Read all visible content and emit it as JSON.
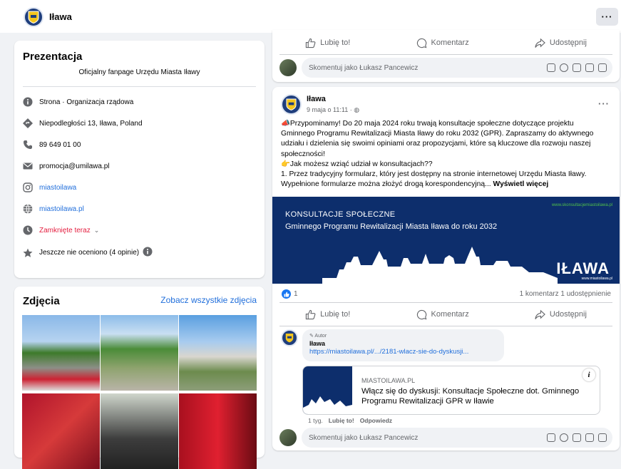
{
  "page": {
    "name": "Iława",
    "more": "···"
  },
  "about": {
    "title": "Prezentacja",
    "description": "Oficjalny fanpage Urzędu Miasta Iławy",
    "items": [
      {
        "icon": "info-icon",
        "text": "Strona · Organizacja rządowa"
      },
      {
        "icon": "location-icon",
        "text": "Niepodległości 13, Iława, Poland"
      },
      {
        "icon": "phone-icon",
        "text": "89 649 01 00"
      },
      {
        "icon": "email-icon",
        "text": "promocja@umilawa.pl"
      },
      {
        "icon": "instagram-icon",
        "text": "miastoilawa"
      },
      {
        "icon": "globe-icon",
        "text": "miastoilawa.pl"
      },
      {
        "icon": "clock-icon",
        "text": "Zamknięte teraz"
      },
      {
        "icon": "star-icon",
        "text": "Jeszcze nie oceniono (4 opinie)"
      }
    ]
  },
  "photos": {
    "title": "Zdjęcia",
    "see_all": "Zobacz wszystkie zdjęcia"
  },
  "actions": {
    "like": "Lubię to!",
    "comment": "Komentarz",
    "share": "Udostępnij"
  },
  "comment_box": {
    "placeholder": "Skomentuj jako Łukasz Pancewicz"
  },
  "post": {
    "author": "Iława",
    "date": "9 maja o 11:11 · ",
    "text_lines": [
      "📣Przypominamy! Do 20 maja 2024 roku trwają konsultacje społeczne dotyczące projektu",
      "Gminnego Programu Rewitalizacji Miasta Iławy do roku 2032 (GPR). Zapraszamy do aktywnego",
      "udziału i dzielenia się swoimi opiniami oraz propozycjami, które są kluczowe dla rozwoju naszej",
      "społeczności!",
      "👉Jak możesz wziąć udział w konsultacjach??",
      "1. Przez tradycyjny formularz, który jest dostępny na stronie internetowej Urzędu Miasta Iławy.",
      "Wypełnione formularze można złożyć drogą korespondencyjną... "
    ],
    "see_more": "Wyświetl więcej",
    "banner": {
      "line1": "KONSULTACJE SPOŁECZNE",
      "line2": "Gminnego Programu Rewitalizacji Miasta Iława do roku 2032",
      "url": "www.skonsultacjemiastoilawa.pl",
      "brand": "IŁAWA",
      "url2": "www.miastoilawa.pl"
    },
    "likes": "1",
    "stats": "1 komentarz  1 udostępnienie"
  },
  "comment": {
    "badge": "✎ Autor",
    "name": "Iława",
    "link": "https://miastoilawa.pl/.../2181-wlacz-sie-do-dyskusji...",
    "preview_domain": "MIASTOILAWA.PL",
    "preview_title": "Włącz się do dyskusji: Konsultacje Społeczne dot. Gminnego Programu Rewitalizacji GPR w Iławie",
    "time": "1 tyg.",
    "like": "Lubię to!",
    "reply": "Odpowiedz"
  },
  "colors": {
    "accent": "#216fdb",
    "banner": "#0d2e6c",
    "closed": "#e41e3f"
  }
}
